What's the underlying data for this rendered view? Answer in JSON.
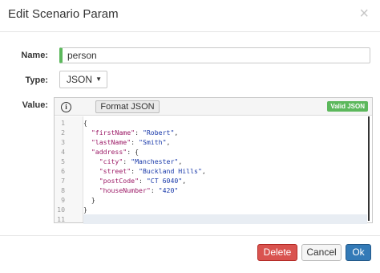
{
  "dialog": {
    "title": "Edit Scenario Param",
    "close_symbol": "×"
  },
  "form": {
    "name_label": "Name:",
    "name_value": "person",
    "type_label": "Type:",
    "type_value": "JSON",
    "value_label": "Value:"
  },
  "editor": {
    "info_icon": "i",
    "format_button": "Format JSON",
    "valid_badge": "Valid JSON",
    "badge_color": "#5cb85c",
    "line_numbers": [
      "1",
      "2",
      "3",
      "4",
      "5",
      "6",
      "7",
      "8",
      "9",
      "10",
      "11"
    ],
    "lines": [
      [
        {
          "t": "p",
          "v": "{"
        }
      ],
      [
        {
          "t": "p",
          "v": "  "
        },
        {
          "t": "k",
          "v": "\"firstName\""
        },
        {
          "t": "p",
          "v": ": "
        },
        {
          "t": "s",
          "v": "\"Robert\""
        },
        {
          "t": "p",
          "v": ","
        }
      ],
      [
        {
          "t": "p",
          "v": "  "
        },
        {
          "t": "k",
          "v": "\"lastName\""
        },
        {
          "t": "p",
          "v": ": "
        },
        {
          "t": "s",
          "v": "\"Smith\""
        },
        {
          "t": "p",
          "v": ","
        }
      ],
      [
        {
          "t": "p",
          "v": "  "
        },
        {
          "t": "k",
          "v": "\"address\""
        },
        {
          "t": "p",
          "v": ": {"
        }
      ],
      [
        {
          "t": "p",
          "v": "    "
        },
        {
          "t": "k",
          "v": "\"city\""
        },
        {
          "t": "p",
          "v": ": "
        },
        {
          "t": "s",
          "v": "\"Manchester\""
        },
        {
          "t": "p",
          "v": ","
        }
      ],
      [
        {
          "t": "p",
          "v": "    "
        },
        {
          "t": "k",
          "v": "\"street\""
        },
        {
          "t": "p",
          "v": ": "
        },
        {
          "t": "s",
          "v": "\"Buckland Hills\""
        },
        {
          "t": "p",
          "v": ","
        }
      ],
      [
        {
          "t": "p",
          "v": "    "
        },
        {
          "t": "k",
          "v": "\"postCode\""
        },
        {
          "t": "p",
          "v": ": "
        },
        {
          "t": "s",
          "v": "\"CT 6040\""
        },
        {
          "t": "p",
          "v": ","
        }
      ],
      [
        {
          "t": "p",
          "v": "    "
        },
        {
          "t": "k",
          "v": "\"houseNumber\""
        },
        {
          "t": "p",
          "v": ": "
        },
        {
          "t": "s",
          "v": "\"420\""
        }
      ],
      [
        {
          "t": "p",
          "v": "  }"
        }
      ],
      [
        {
          "t": "p",
          "v": "}"
        }
      ],
      [
        {
          "t": "p",
          "v": ""
        }
      ]
    ]
  },
  "footer": {
    "delete_label": "Delete",
    "cancel_label": "Cancel",
    "ok_label": "Ok",
    "delete_color": "#d9534f",
    "ok_color": "#337ab7"
  }
}
